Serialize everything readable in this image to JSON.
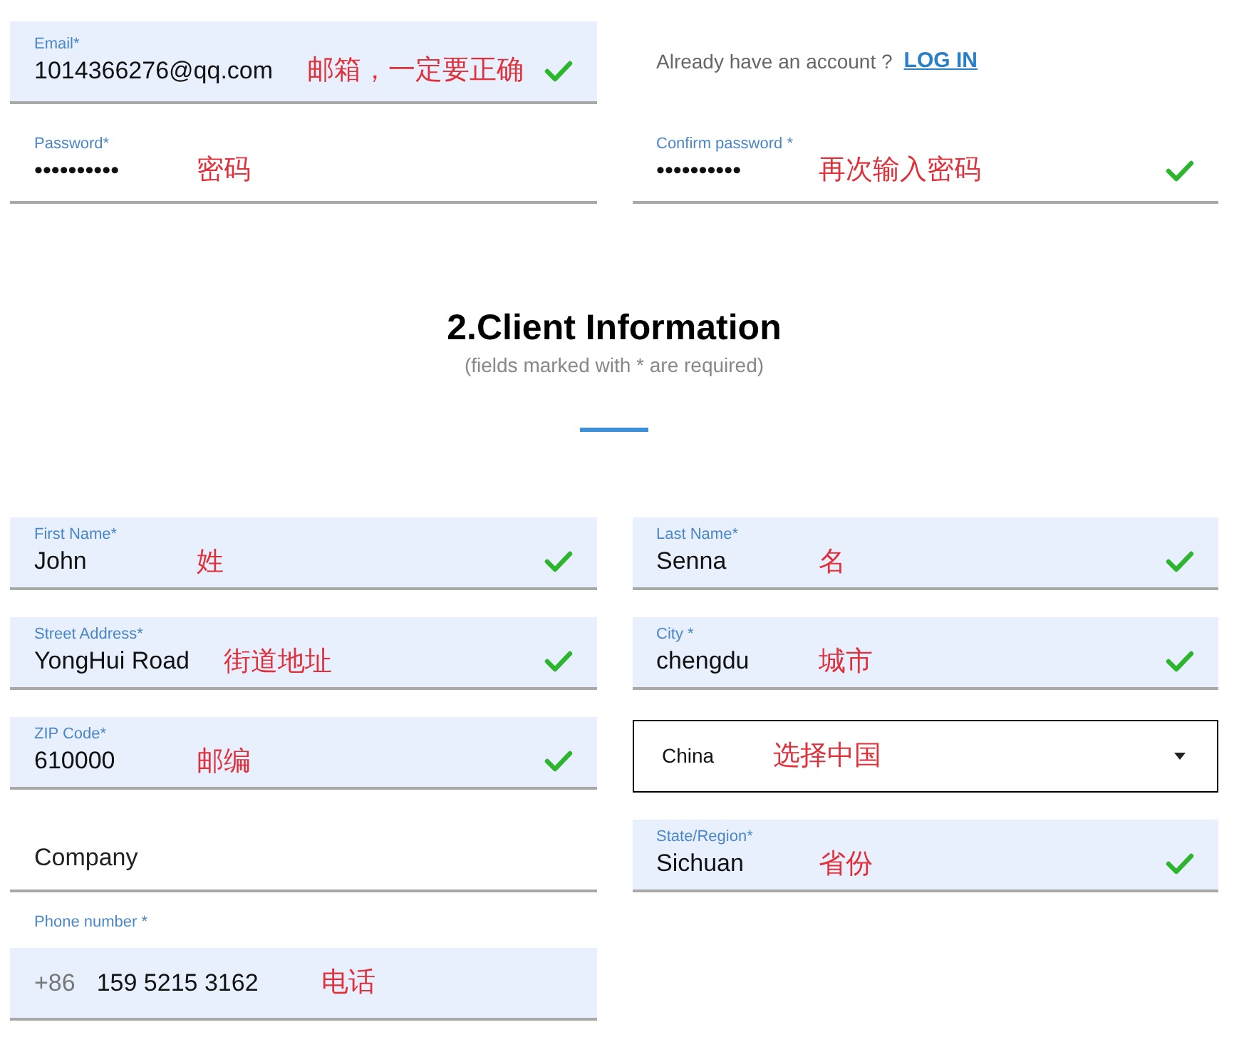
{
  "account": {
    "email": {
      "label": "Email*",
      "value": "1014366276@qq.com",
      "autofilled": true,
      "valid": true,
      "annotation": "邮箱，一定要正确"
    },
    "login_prompt": {
      "text": "Already have an account ?",
      "link": "LOG IN"
    },
    "password": {
      "label": "Password*",
      "value": "••••••••••",
      "autofilled": false,
      "valid": false,
      "annotation": "密码"
    },
    "confirm_password": {
      "label": "Confirm password *",
      "value": "••••••••••",
      "autofilled": false,
      "valid": true,
      "annotation": "再次输入密码"
    }
  },
  "section": {
    "title": "2.Client Information",
    "subtitle": "(fields marked with * are required)"
  },
  "rows": [
    [
      {
        "kind": "text",
        "label": "First Name*",
        "value": "John",
        "autofilled": true,
        "valid": true,
        "annotation": "姓"
      },
      {
        "kind": "text",
        "label": "Last Name*",
        "value": "Senna",
        "autofilled": true,
        "valid": true,
        "annotation": "名"
      }
    ],
    [
      {
        "kind": "text",
        "label": "Street Address*",
        "value": "YongHui Road",
        "autofilled": true,
        "valid": true,
        "annotation": "街道地址"
      },
      {
        "kind": "text",
        "label": "City *",
        "value": "chengdu",
        "autofilled": true,
        "valid": true,
        "annotation": "城市"
      }
    ],
    [
      {
        "kind": "text",
        "label": "ZIP Code*",
        "value": "610000",
        "autofilled": true,
        "valid": true,
        "annotation": "邮编"
      },
      {
        "kind": "select",
        "value": "China",
        "annotation": "选择中国"
      }
    ],
    [
      {
        "kind": "text",
        "placeholder": "Company",
        "autofilled": false,
        "valid": false
      },
      {
        "kind": "text",
        "label": "State/Region*",
        "value": "Sichuan",
        "autofilled": true,
        "valid": true,
        "annotation": "省份"
      }
    ],
    [
      {
        "kind": "phone",
        "label": "Phone number *",
        "prefix": "+86",
        "value": "159 5215 3162",
        "autofilled": true,
        "annotation": "电话"
      }
    ]
  ]
}
